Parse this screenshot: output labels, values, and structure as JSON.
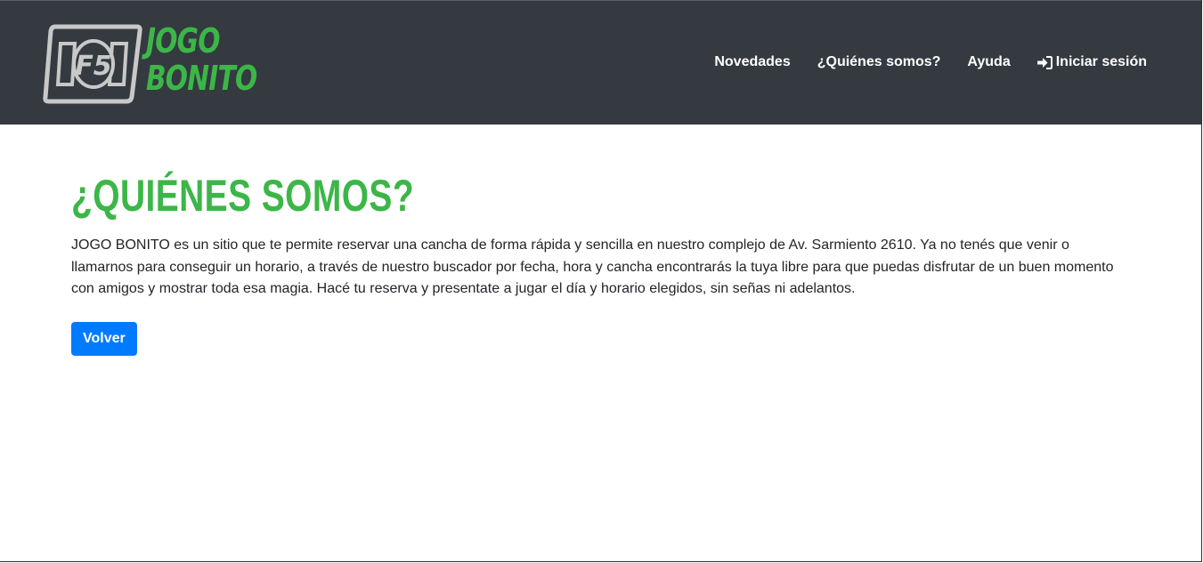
{
  "brand": {
    "logo_text": "F5",
    "name_line1": "JOGO",
    "name_line2": "BONITO"
  },
  "nav": {
    "items": [
      {
        "label": "Novedades"
      },
      {
        "label": "¿Quiénes somos?"
      },
      {
        "label": "Ayuda"
      },
      {
        "label": "Iniciar sesión",
        "icon": "sign-in-icon"
      }
    ]
  },
  "main": {
    "title": "¿QUIÉNES SOMOS?",
    "paragraph": "JOGO BONITO es un sitio que te permite reservar una cancha de forma rápida y sencilla en nuestro complejo de Av. Sarmiento 2610. Ya no tenés que venir o llamarnos para conseguir un horario, a través de nuestro buscador por fecha, hora y cancha encontrarás la tuya libre para que puedas disfrutar de un buen momento con amigos y mostrar toda esa magia. Hacé tu reserva y presentate a jugar el día y horario elegidos, sin señas ni adelantos.",
    "back_button": "Volver"
  },
  "colors": {
    "navbar_bg": "#343a40",
    "brand_green": "#3cb648",
    "logo_gray": "#c8c8c8",
    "button_blue": "#007bff"
  }
}
